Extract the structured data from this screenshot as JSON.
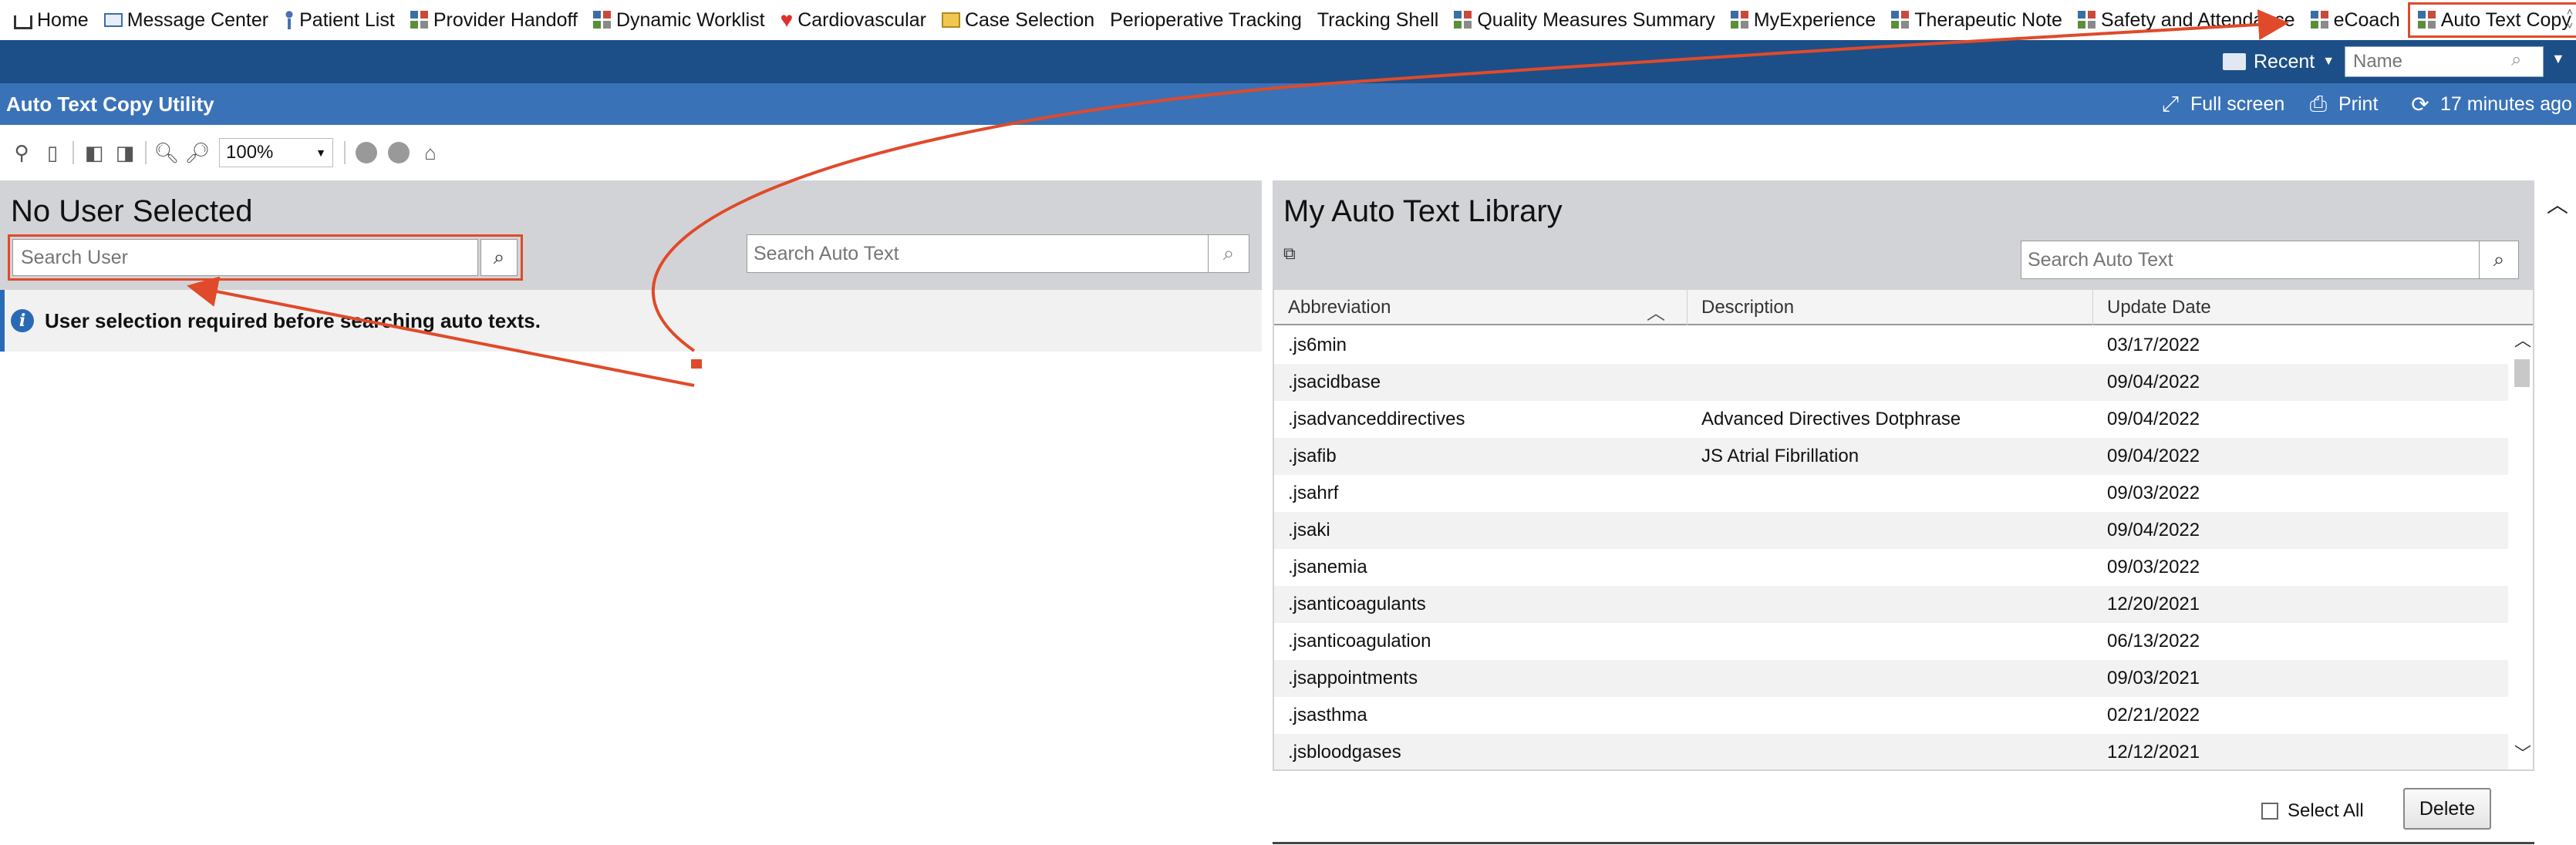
{
  "tabs": [
    {
      "label": "Home",
      "icon": "home-icon"
    },
    {
      "label": "Message Center",
      "icon": "mail-icon"
    },
    {
      "label": "Patient List",
      "icon": "person-icon"
    },
    {
      "label": "Provider Handoff",
      "icon": "grid-icon"
    },
    {
      "label": "Dynamic Worklist",
      "icon": "grid-icon"
    },
    {
      "label": "Cardiovascular",
      "icon": "heart-icon"
    },
    {
      "label": "Case Selection",
      "icon": "folder-icon"
    },
    {
      "label": "Perioperative Tracking",
      "icon": ""
    },
    {
      "label": "Tracking Shell",
      "icon": ""
    },
    {
      "label": "Quality Measures Summary",
      "icon": "grid-icon"
    },
    {
      "label": "MyExperience",
      "icon": "grid-icon"
    },
    {
      "label": "Therapeutic Note",
      "icon": "grid-icon"
    },
    {
      "label": "Safety and Attendance",
      "icon": "grid-icon"
    },
    {
      "label": "eCoach",
      "icon": "grid-icon"
    },
    {
      "label": "Auto Text Copy Utility",
      "icon": "grid-icon",
      "active": true
    }
  ],
  "navbar": {
    "recent_label": "Recent",
    "name_placeholder": "Name"
  },
  "titlebar": {
    "title": "Auto Text Copy Utility",
    "fullscreen_label": "Full screen",
    "print_label": "Print",
    "refresh_label": "17 minutes ago"
  },
  "toolbar": {
    "zoom": "100%"
  },
  "left": {
    "title": "No User Selected",
    "search_user_placeholder": "Search User",
    "search_auto_placeholder": "Search Auto Text",
    "info_message": "User selection required before searching auto texts."
  },
  "right": {
    "title": "My Auto Text Library",
    "search_auto_placeholder": "Search Auto Text",
    "columns": [
      "Abbreviation",
      "Description",
      "Update Date"
    ],
    "rows": [
      {
        "abbr": ".js6min",
        "desc": "",
        "date": "03/17/2022"
      },
      {
        "abbr": ".jsacidbase",
        "desc": "",
        "date": "09/04/2022"
      },
      {
        "abbr": ".jsadvanceddirectives",
        "desc": "Advanced Directives Dotphrase",
        "date": "09/04/2022"
      },
      {
        "abbr": ".jsafib",
        "desc": "JS Atrial Fibrillation",
        "date": "09/04/2022"
      },
      {
        "abbr": ".jsahrf",
        "desc": "",
        "date": "09/03/2022"
      },
      {
        "abbr": ".jsaki",
        "desc": "",
        "date": "09/04/2022"
      },
      {
        "abbr": ".jsanemia",
        "desc": "",
        "date": "09/03/2022"
      },
      {
        "abbr": ".jsanticoagulants",
        "desc": "",
        "date": "12/20/2021"
      },
      {
        "abbr": ".jsanticoagulation",
        "desc": "",
        "date": "06/13/2022"
      },
      {
        "abbr": ".jsappointments",
        "desc": "",
        "date": "09/03/2021"
      },
      {
        "abbr": ".jsasthma",
        "desc": "",
        "date": "02/21/2022"
      },
      {
        "abbr": ".jsbloodgases",
        "desc": "",
        "date": "12/12/2021"
      }
    ],
    "select_all_label": "Select All",
    "delete_label": "Delete"
  },
  "colors": {
    "navbar": "#1c4f87",
    "titlebar": "#3a72b8",
    "panel": "#d2d3d6",
    "annotation": "#e04a2a",
    "info": "#2a6ab5"
  }
}
